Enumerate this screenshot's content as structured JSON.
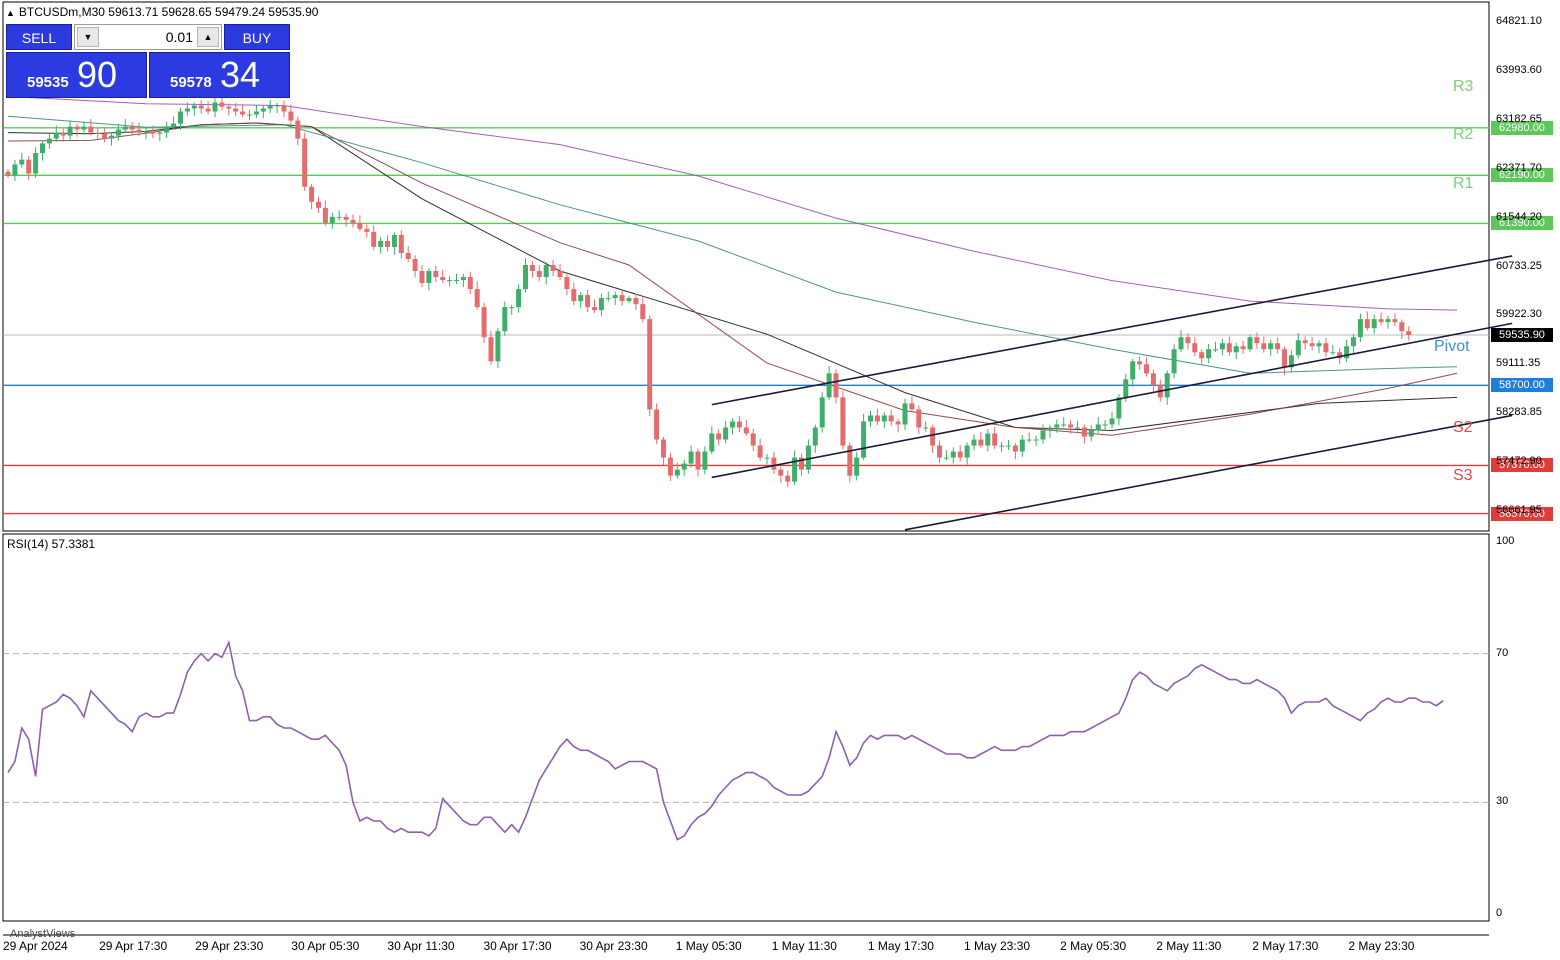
{
  "header": {
    "symbol_line": "BTCUSDm,M30  59613.71 59628.65 59479.24 59535.90",
    "collapse_icon": "triangle-up-icon"
  },
  "trade_panel": {
    "sell_label": "SELL",
    "buy_label": "BUY",
    "lot": "0.01",
    "sell_price_small": "59535",
    "sell_price_big": "90",
    "buy_price_small": "59578",
    "buy_price_big": "34",
    "colors": {
      "button": "#2b3be0"
    }
  },
  "labels": {
    "r3": "R3",
    "r2": "R2",
    "r1": "R1",
    "pivot": "Pivot",
    "s2": "S2",
    "s3": "S3",
    "rsi": "RSI(14) 57.3381",
    "cutoff": "AnalystViews"
  },
  "chart_data": [
    {
      "type": "candlestick",
      "symbol": "BTCUSDm",
      "timeframe": "M30",
      "ylim": [
        56280,
        65070
      ],
      "y_ticks": [
        "64821.10",
        "63993.60",
        "63182.65",
        "62371.70",
        "61544.20",
        "60733.25",
        "59922.30",
        "59111.35",
        "58283.85",
        "57472.90",
        "56661.95"
      ],
      "x_ticks": [
        "29 Apr 2024",
        "29 Apr 17:30",
        "29 Apr 23:30",
        "30 Apr 05:30",
        "30 Apr 11:30",
        "30 Apr 17:30",
        "30 Apr 23:30",
        "1 May 05:30",
        "1 May 11:30",
        "1 May 17:30",
        "1 May 23:30",
        "2 May 05:30",
        "2 May 11:30",
        "2 May 17:30",
        "2 May 23:30"
      ],
      "current_price": {
        "value": 59535.9,
        "label": "59535.90"
      },
      "levels": [
        {
          "name": "R3",
          "value": 63800,
          "label": "",
          "color": "#5cc85c"
        },
        {
          "name": "R2",
          "value": 62980,
          "label": "62980.00",
          "color": "#5cc85c"
        },
        {
          "name": "R1",
          "value": 62190,
          "label": "62190.00",
          "color": "#5cc85c"
        },
        {
          "name": "",
          "value": 61390,
          "label": "61390.00",
          "color": "#5cc85c"
        },
        {
          "name": "Pivot",
          "value": 58700,
          "label": "58700.00",
          "color": "#1e7fd8"
        },
        {
          "name": "S2",
          "value": 57370,
          "label": "57370.00",
          "color": "#e03c3c"
        },
        {
          "name": "S3",
          "value": 56570,
          "label": "56570.00",
          "color": "#e03c3c"
        }
      ],
      "closes": [
        62190,
        62370,
        62450,
        62220,
        62560,
        62720,
        62800,
        62900,
        62850,
        63000,
        62950,
        63000,
        62900,
        62880,
        62800,
        62850,
        62950,
        63000,
        62950,
        62900,
        62920,
        62880,
        62900,
        63000,
        63050,
        63250,
        63300,
        63350,
        63300,
        63250,
        63400,
        63330,
        63300,
        63250,
        63200,
        63200,
        63250,
        63300,
        63350,
        63350,
        63250,
        63100,
        62800,
        62000,
        61750,
        61650,
        61400,
        61500,
        61500,
        61450,
        61400,
        61300,
        61250,
        61000,
        61100,
        61000,
        61200,
        60900,
        60800,
        60600,
        60400,
        60600,
        60500,
        60450,
        60450,
        60450,
        60500,
        60300,
        60000,
        59500,
        59100,
        59600,
        60000,
        60000,
        60300,
        60700,
        60600,
        60500,
        60700,
        60600,
        60500,
        60300,
        60100,
        60200,
        60000,
        59950,
        60150,
        60150,
        60200,
        60100,
        60150,
        60050,
        59800,
        58300,
        57800,
        57500,
        57200,
        57300,
        57400,
        57600,
        57300,
        57600,
        57900,
        57800,
        58000,
        58100,
        58000,
        57900,
        57700,
        57500,
        57500,
        57300,
        57200,
        57100,
        57500,
        57300,
        57700,
        58000,
        58500,
        58900,
        58500,
        57700,
        57200,
        57500,
        58100,
        58200,
        58100,
        58200,
        58100,
        58050,
        58400,
        58300,
        58000,
        58000,
        57700,
        57500,
        57500,
        57600,
        57500,
        57700,
        57800,
        57700,
        57900,
        57700,
        57700,
        57700,
        57600,
        57800,
        57800,
        57800,
        57950,
        58000,
        58050,
        58050,
        58000,
        58000,
        57850,
        57950,
        58050,
        58050,
        58150,
        58500,
        58800,
        59100,
        59050,
        58900,
        58700,
        58500,
        58900,
        59300,
        59500,
        59400,
        59250,
        59150,
        59300,
        59300,
        59400,
        59250,
        59350,
        59300,
        59500,
        59400,
        59300,
        59400,
        59300,
        59000,
        59200,
        59450,
        59400,
        59350,
        59400,
        59250,
        59250,
        59150,
        59350,
        59500,
        59800,
        59650,
        59800,
        59750,
        59800,
        59750,
        59600,
        59535.9
      ],
      "indicators": [
        {
          "name": "ma-fast",
          "color": "#1a1a1a",
          "points": [
            [
              0,
              62900
            ],
            [
              12,
              62880
            ],
            [
              20,
              62920
            ],
            [
              28,
              63030
            ],
            [
              36,
              63060
            ],
            [
              44,
              63000
            ],
            [
              60,
              61800
            ],
            [
              80,
              60600
            ],
            [
              110,
              59550
            ],
            [
              130,
              58580
            ],
            [
              146,
              58000
            ],
            [
              160,
              57950
            ],
            [
              190,
              58400
            ],
            [
              210,
              58500
            ]
          ]
        },
        {
          "name": "ma-slow",
          "color": "#8b3a3a",
          "points": [
            [
              0,
              62760
            ],
            [
              12,
              62770
            ],
            [
              20,
              62890
            ],
            [
              28,
              63030
            ],
            [
              36,
              63060
            ],
            [
              44,
              63000
            ],
            [
              60,
              62060
            ],
            [
              80,
              61070
            ],
            [
              90,
              60700
            ],
            [
              110,
              59070
            ],
            [
              130,
              58280
            ],
            [
              146,
              58000
            ],
            [
              160,
              57870
            ],
            [
              180,
              58220
            ],
            [
              200,
              58650
            ],
            [
              210,
              58900
            ]
          ]
        },
        {
          "name": "ma-teal",
          "color": "#3a8a7a",
          "points": [
            [
              0,
              63170
            ],
            [
              20,
              62990
            ],
            [
              40,
              63030
            ],
            [
              60,
              62400
            ],
            [
              80,
              61700
            ],
            [
              100,
              61100
            ],
            [
              120,
              60250
            ],
            [
              140,
              59750
            ],
            [
              160,
              59300
            ],
            [
              180,
              58900
            ],
            [
              200,
              58980
            ],
            [
              210,
              59010
            ]
          ]
        },
        {
          "name": "ma-purple",
          "color": "#9a4fb0",
          "points": [
            [
              0,
              63500
            ],
            [
              20,
              63380
            ],
            [
              40,
              63350
            ],
            [
              60,
              63000
            ],
            [
              80,
              62700
            ],
            [
              100,
              62180
            ],
            [
              120,
              61480
            ],
            [
              140,
              60930
            ],
            [
              160,
              60440
            ],
            [
              180,
              60100
            ],
            [
              200,
              59970
            ],
            [
              210,
              59950
            ]
          ]
        }
      ],
      "trend_lines": [
        {
          "name": "channel-upper",
          "points": [
            [
              102,
              58380
            ],
            [
              218,
              60850
            ]
          ]
        },
        {
          "name": "channel-middle",
          "points": [
            [
              102,
              57170
            ],
            [
              218,
              59730
            ]
          ]
        },
        {
          "name": "channel-lower",
          "points": [
            [
              130,
              56300
            ],
            [
              218,
              58200
            ]
          ]
        }
      ]
    },
    {
      "type": "line",
      "name": "RSI(14)",
      "title": "RSI(14) 57.3381",
      "current": 57.3381,
      "ylim": [
        0,
        100
      ],
      "y_ticks": [
        "100",
        "70",
        "30",
        "0"
      ],
      "levels": [
        70,
        30
      ],
      "series": [
        {
          "values": [
            38,
            41,
            50,
            47,
            37,
            55,
            56,
            57,
            59,
            58,
            56,
            53,
            60,
            58,
            56,
            54,
            52,
            51,
            49,
            53,
            54,
            53,
            53,
            54,
            54,
            59,
            65,
            68,
            70,
            68,
            70,
            69,
            73,
            64,
            60,
            52,
            52,
            53,
            53,
            51,
            50,
            50,
            49,
            48,
            47,
            47,
            48,
            46,
            44,
            40,
            30,
            25,
            26,
            25,
            25,
            23,
            22,
            23,
            22,
            22,
            22,
            21,
            23,
            31,
            29,
            27,
            25,
            24,
            24,
            26,
            26,
            24,
            22,
            24,
            22,
            26,
            31,
            36,
            39,
            42,
            45,
            47,
            45,
            44,
            44,
            43,
            42,
            41,
            39,
            40,
            41,
            41,
            41,
            40,
            39,
            30,
            25,
            20,
            21,
            24,
            26,
            27,
            29,
            32,
            34,
            36,
            37,
            38,
            38,
            37,
            36,
            34,
            33,
            32,
            32,
            32,
            33,
            35,
            37,
            42,
            49,
            45,
            40,
            42,
            46,
            48,
            47,
            48,
            48,
            48,
            47,
            48,
            47,
            46,
            45,
            44,
            43,
            43,
            43,
            42,
            42,
            43,
            44,
            45,
            44,
            44,
            44,
            45,
            45,
            46,
            47,
            48,
            48,
            48,
            49,
            49,
            49,
            50,
            51,
            52,
            53,
            54,
            58,
            63,
            65,
            64,
            62,
            61,
            60,
            62,
            63,
            64,
            66,
            67,
            66,
            65,
            64,
            63,
            63,
            62,
            62,
            63,
            62,
            61,
            60,
            58,
            54,
            56,
            57,
            57,
            57,
            58,
            56,
            55,
            54,
            53,
            52,
            54,
            55,
            57,
            58,
            57,
            57,
            58,
            58,
            57,
            57,
            56,
            57.3381
          ]
        }
      ]
    }
  ]
}
